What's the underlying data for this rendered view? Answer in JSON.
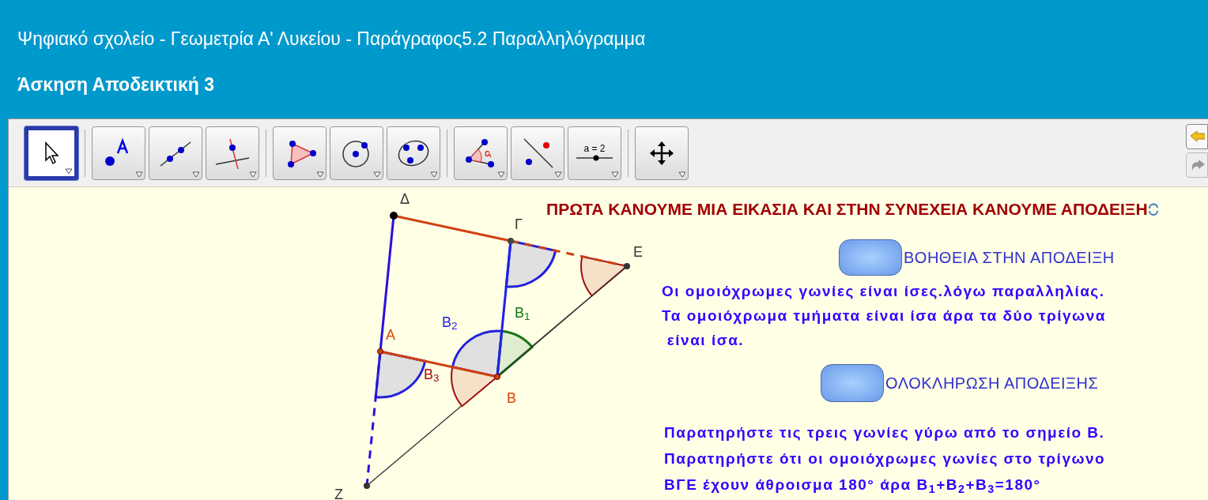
{
  "header": {
    "title": "Ψηφιακό σχολείο - Γεωμετρία Α' Λυκείου - Παράγραφος5.2 Παραλληλόγραμμα",
    "subtitle": "Άσκηση Αποδεικτική 3"
  },
  "toolbar": {
    "tools": [
      {
        "kind": "move",
        "selected": true
      },
      {
        "kind": "point",
        "selected": false
      },
      {
        "kind": "line",
        "selected": false
      },
      {
        "kind": "perpendicular",
        "selected": false
      },
      {
        "kind": "polygon",
        "selected": false
      },
      {
        "kind": "circle",
        "selected": false
      },
      {
        "kind": "conic",
        "selected": false
      },
      {
        "kind": "angle",
        "selected": false
      },
      {
        "kind": "reflect",
        "selected": false
      },
      {
        "kind": "slider",
        "selected": false,
        "label": "a = 2"
      },
      {
        "kind": "pan",
        "selected": false
      }
    ],
    "undo": {
      "disabled": false
    },
    "redo": {
      "disabled": true
    }
  },
  "canvas": {
    "heading": "ΠΡΩΤΑ ΚΑΝΟΥΜΕ ΜΙΑ ΕΙΚΑΣΙΑ ΚΑΙ ΣΤΗΝ ΣΥΝΕΧΕΙΑ ΚΑΝΟΥΜΕ ΑΠΟΔΕΙΞΗ",
    "labels": [
      {
        "text": "Δ",
        "color": "#333333"
      },
      {
        "text": "Γ",
        "color": "#333333"
      },
      {
        "text": "Ε",
        "color": "#333333"
      },
      {
        "text": "Α",
        "color": "#dd4400"
      },
      {
        "text": "Β",
        "color": "#dd4400"
      },
      {
        "text": "Ζ",
        "color": "#333333"
      },
      {
        "text": "Β$_{2}$",
        "color": "#2222dd"
      },
      {
        "text": "Β$_{1}$",
        "color": "#117711"
      },
      {
        "text": "Β$_{3}$",
        "color": "#a01010"
      }
    ],
    "help_button": {
      "label": "ΒΟΗΘΕΙΑ ΣΤΗΝ ΑΠΟΔΕΙΞΗ"
    },
    "help_text": [
      "Οι ομοιόχρωμες γωνίες είναι ίσες.λόγω παραλληλίας.",
      "Τα ομοιόχρωμα τμήματα είναι ίσα άρα τα δύο τρίγωνα",
      " είναι ίσα."
    ],
    "finish_button": {
      "label": "ΟΛΟΚΛΗΡΩΣΗ ΑΠΟΔΕΙΞΗΣ"
    },
    "finish_text": [
      "Παρατηρήστε τις τρεις γωνίες γύρω από το σημείο Β.",
      "Παρατηρήστε ότι οι ομοιόχρωμες γωνίες στο τρίγωνο",
      "ΒΓΕ έχουν άθροισμα 180° άρα Β$_{1}$+Β$_{2}$+Β$_{3}$=180°"
    ]
  }
}
